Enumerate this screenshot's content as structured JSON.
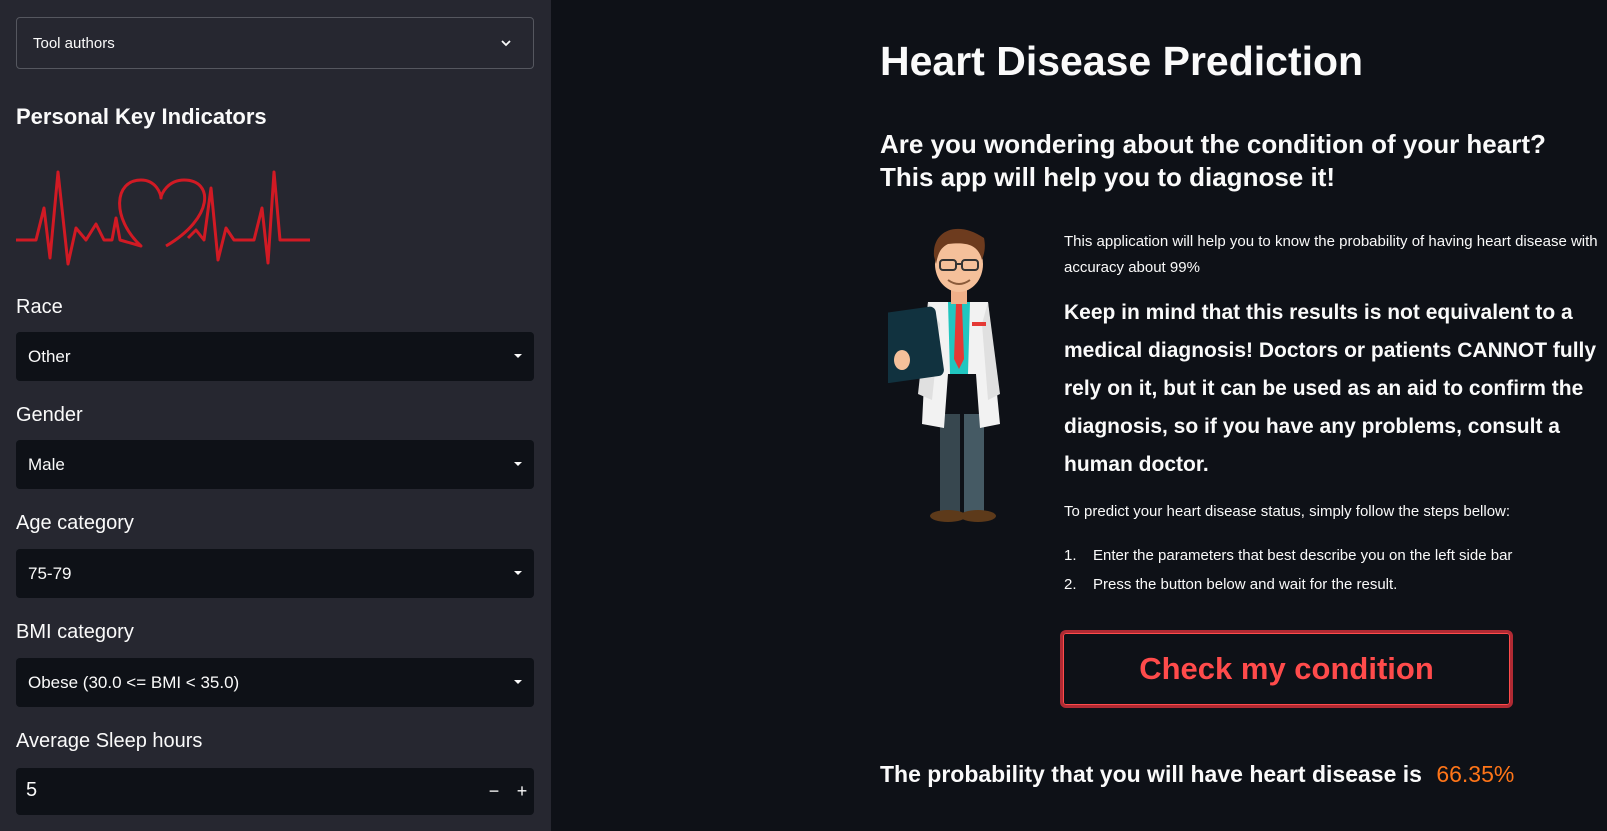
{
  "sidebar": {
    "authors_expander": "Tool authors",
    "heading": "Personal Key Indicators",
    "race": {
      "label": "Race",
      "value": "Other"
    },
    "gender": {
      "label": "Gender",
      "value": "Male"
    },
    "age": {
      "label": "Age category",
      "value": "75-79"
    },
    "bmi": {
      "label": "BMI category",
      "value": "Obese (30.0 <= BMI < 35.0)"
    },
    "sleep": {
      "label": "Average Sleep hours",
      "value": "5",
      "minus": "−",
      "plus": "+"
    }
  },
  "main": {
    "title": "Heart Disease Prediction",
    "subtitle": "Are you wondering about the condition of your heart? This app will help you to diagnose it!",
    "intro": "This application will help you to know the probability of having heart disease with accuracy about 99%",
    "warning": "Keep in mind that this results is not equivalent to a medical diagnosis! Doctors or patients CANNOT fully rely on it, but it can be used as an aid to confirm the diagnosis, so if you have any problems, consult a human doctor.",
    "steps_intro": "To predict your heart disease status, simply follow the steps bellow:",
    "steps": [
      {
        "num": "1.",
        "text": "Enter the parameters that best describe you on the left side bar"
      },
      {
        "num": "2.",
        "text": "Press the button below and wait for the result."
      }
    ],
    "button": "Check my condition",
    "result_text": "The probability that you will have heart disease is",
    "result_value": "66.35%"
  },
  "colors": {
    "accent": "#ff4b4b",
    "result": "#ff7518",
    "sidebar_bg": "#262730",
    "main_bg": "#0e1117"
  },
  "icons": [
    "chevron-down-icon",
    "ecg-heart-logo",
    "doctor-illustration",
    "select-caret-icon"
  ]
}
